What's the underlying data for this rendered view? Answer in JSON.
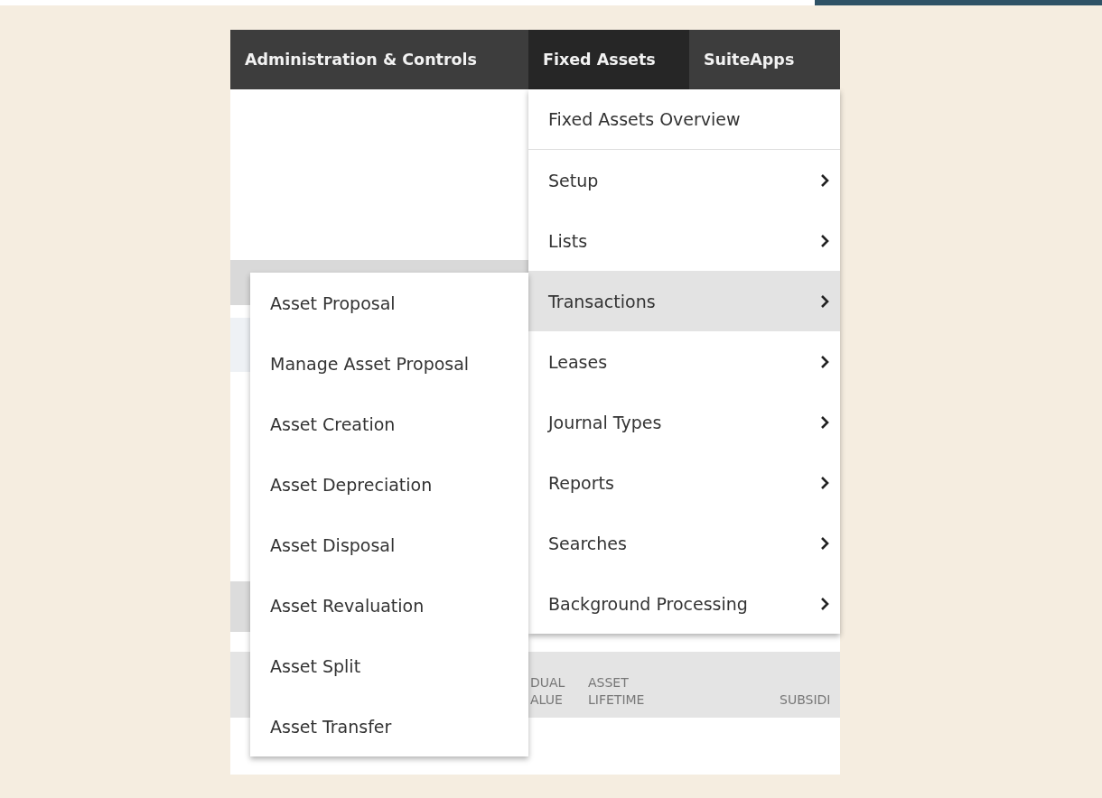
{
  "nav_tabs": [
    {
      "label": "Administration & Controls",
      "selected": false
    },
    {
      "label": "Fixed Assets",
      "selected": true
    },
    {
      "label": "SuiteApps",
      "selected": false
    }
  ],
  "menu": {
    "items": [
      {
        "label": "Fixed Assets Overview",
        "has_submenu": false,
        "selected": false
      },
      {
        "label": "Setup",
        "has_submenu": true,
        "selected": false
      },
      {
        "label": "Lists",
        "has_submenu": true,
        "selected": false
      },
      {
        "label": "Transactions",
        "has_submenu": true,
        "selected": true
      },
      {
        "label": "Leases",
        "has_submenu": true,
        "selected": false
      },
      {
        "label": "Journal Types",
        "has_submenu": true,
        "selected": false
      },
      {
        "label": "Reports",
        "has_submenu": true,
        "selected": false
      },
      {
        "label": "Searches",
        "has_submenu": true,
        "selected": false
      },
      {
        "label": "Background Processing",
        "has_submenu": true,
        "selected": false
      }
    ]
  },
  "submenu": {
    "items": [
      {
        "label": "Asset Proposal"
      },
      {
        "label": "Manage Asset Proposal"
      },
      {
        "label": "Asset Creation"
      },
      {
        "label": "Asset Depreciation"
      },
      {
        "label": "Asset Disposal"
      },
      {
        "label": "Asset Revaluation"
      },
      {
        "label": "Asset Split"
      },
      {
        "label": "Asset Transfer"
      }
    ]
  },
  "table": {
    "columns": [
      "DUAL\nALUE",
      "ASSET\nLIFETIME",
      "SUBSIDI"
    ]
  }
}
